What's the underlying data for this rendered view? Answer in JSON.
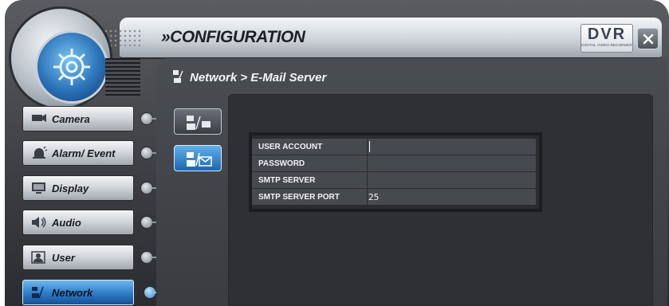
{
  "header": {
    "title": "»CONFIGURATION",
    "logo_main": "DVR",
    "logo_sub": "DIGITAL VIDEO RECORDER",
    "close_label": "×"
  },
  "breadcrumb": "Network > E-Mail Server",
  "sidebar": {
    "items": [
      {
        "label": "Camera",
        "icon": "camera-icon"
      },
      {
        "label": "Alarm/ Event",
        "icon": "alarm-icon"
      },
      {
        "label": "Display",
        "icon": "display-icon"
      },
      {
        "label": "Audio",
        "icon": "speaker-icon"
      },
      {
        "label": "User",
        "icon": "user-icon"
      },
      {
        "label": "Network",
        "icon": "network-icon",
        "active": true
      }
    ]
  },
  "subtabs": [
    {
      "icon": "network-settings-icon",
      "active": false
    },
    {
      "icon": "email-network-icon",
      "active": true
    }
  ],
  "form": {
    "rows": [
      {
        "label": "USER ACCOUNT",
        "value": ""
      },
      {
        "label": "PASSWORD",
        "value": ""
      },
      {
        "label": "SMTP SERVER",
        "value": ""
      },
      {
        "label": "SMTP SERVER PORT",
        "value": "25"
      }
    ]
  },
  "colors": {
    "accent_blue": "#2d7bc6",
    "panel_dark": "#2e3033",
    "field_gray": "#46494e"
  }
}
